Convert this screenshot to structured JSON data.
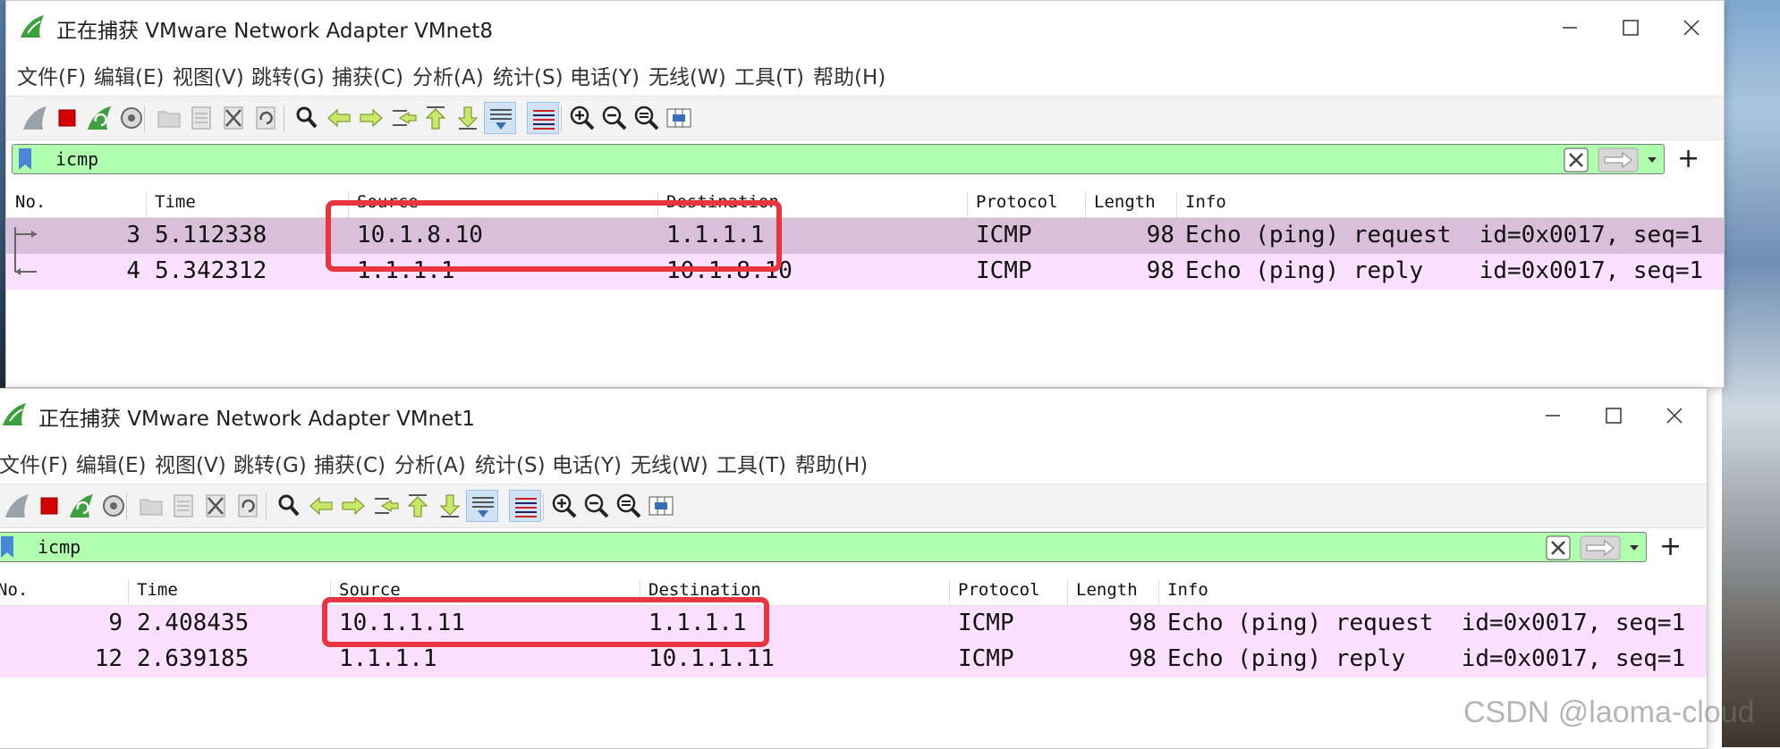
{
  "menu": [
    "文件(F)",
    "编辑(E)",
    "视图(V)",
    "跳转(G)",
    "捕获(C)",
    "分析(A)",
    "统计(S)",
    "电话(Y)",
    "无线(W)",
    "工具(T)",
    "帮助(H)"
  ],
  "columns": {
    "no": "No.",
    "time": "Time",
    "source": "Source",
    "destination": "Destination",
    "protocol": "Protocol",
    "length": "Length",
    "info": "Info"
  },
  "toolbar_icons": [
    "shark-fin-start-icon",
    "stop-capture-icon",
    "restart-capture-icon",
    "capture-options-icon",
    "open-file-icon",
    "save-file-icon",
    "close-file-icon",
    "reload-file-icon",
    "find-packet-icon",
    "go-back-icon",
    "go-forward-icon",
    "go-to-packet-icon",
    "first-packet-icon",
    "last-packet-icon",
    "autoscroll-icon",
    "colorize-icon",
    "zoom-in-icon",
    "zoom-out-icon",
    "normal-size-icon",
    "resize-columns-icon"
  ],
  "windows": [
    {
      "title": "正在捕获 VMware Network Adapter VMnet8",
      "filter": "icmp",
      "packets": [
        {
          "no": "3",
          "time": "5.112338",
          "source": "10.1.8.10",
          "destination": "1.1.1.1",
          "protocol": "ICMP",
          "length": "98",
          "info": "Echo (ping) request  id=0x0017, seq=1"
        },
        {
          "no": "4",
          "time": "5.342312",
          "source": "1.1.1.1",
          "destination": "10.1.8.10",
          "protocol": "ICMP",
          "length": "98",
          "info": "Echo (ping) reply    id=0x0017, seq=1"
        }
      ]
    },
    {
      "title": "正在捕获 VMware Network Adapter VMnet1",
      "filter": "icmp",
      "packets": [
        {
          "no": "9",
          "time": "2.408435",
          "source": "10.1.1.11",
          "destination": "1.1.1.1",
          "protocol": "ICMP",
          "length": "98",
          "info": "Echo (ping) request  id=0x0017, seq=1"
        },
        {
          "no": "12",
          "time": "2.639185",
          "source": "1.1.1.1",
          "destination": "10.1.1.11",
          "protocol": "ICMP",
          "length": "98",
          "info": "Echo (ping) reply    id=0x0017, seq=1"
        }
      ]
    }
  ],
  "colors": {
    "filter_valid": "#afffaf",
    "row_selected": "#d9bfda",
    "row_icmp": "#fce0ff",
    "highlight": "#e8353f"
  },
  "watermark": "CSDN @laoma-cloud"
}
